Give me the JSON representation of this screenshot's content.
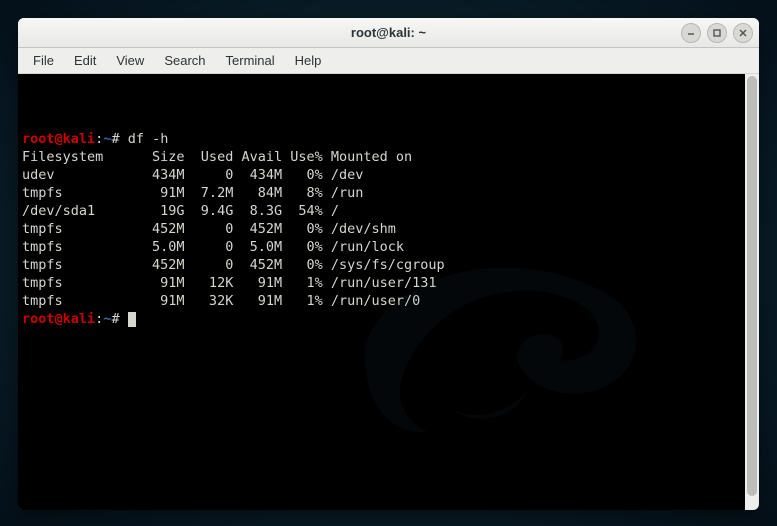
{
  "window": {
    "title": "root@kali: ~"
  },
  "menu": {
    "file": "File",
    "edit": "Edit",
    "view": "View",
    "search": "Search",
    "terminal": "Terminal",
    "help": "Help"
  },
  "prompt": {
    "user_host": "root@kali",
    "sep": ":",
    "path": "~",
    "symbol": "#"
  },
  "command": "df -h",
  "df": {
    "header": {
      "fs": "Filesystem",
      "size": "Size",
      "used": "Used",
      "avail": "Avail",
      "usep": "Use%",
      "mount": "Mounted on"
    },
    "rows": [
      {
        "fs": "udev",
        "size": "434M",
        "used": "0",
        "avail": "434M",
        "usep": "0%",
        "mount": "/dev"
      },
      {
        "fs": "tmpfs",
        "size": "91M",
        "used": "7.2M",
        "avail": "84M",
        "usep": "8%",
        "mount": "/run"
      },
      {
        "fs": "/dev/sda1",
        "size": "19G",
        "used": "9.4G",
        "avail": "8.3G",
        "usep": "54%",
        "mount": "/"
      },
      {
        "fs": "tmpfs",
        "size": "452M",
        "used": "0",
        "avail": "452M",
        "usep": "0%",
        "mount": "/dev/shm"
      },
      {
        "fs": "tmpfs",
        "size": "5.0M",
        "used": "0",
        "avail": "5.0M",
        "usep": "0%",
        "mount": "/run/lock"
      },
      {
        "fs": "tmpfs",
        "size": "452M",
        "used": "0",
        "avail": "452M",
        "usep": "0%",
        "mount": "/sys/fs/cgroup"
      },
      {
        "fs": "tmpfs",
        "size": "91M",
        "used": "12K",
        "avail": "91M",
        "usep": "1%",
        "mount": "/run/user/131"
      },
      {
        "fs": "tmpfs",
        "size": "91M",
        "used": "32K",
        "avail": "91M",
        "usep": "1%",
        "mount": "/run/user/0"
      }
    ]
  }
}
